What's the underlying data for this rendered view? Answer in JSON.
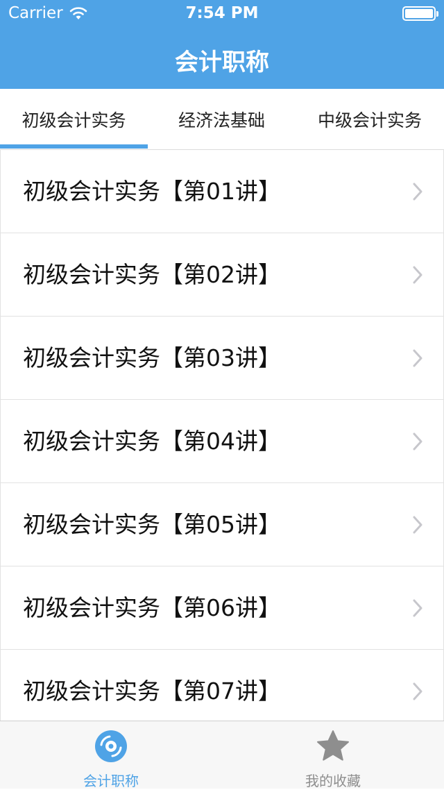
{
  "status_bar": {
    "carrier": "Carrier",
    "time": "7:54 PM"
  },
  "nav": {
    "title": "会计职称"
  },
  "tabs": [
    {
      "label": "初级会计实务",
      "selected": true
    },
    {
      "label": "经济法基础",
      "selected": false
    },
    {
      "label": "中级会计实务",
      "selected": false
    }
  ],
  "list": {
    "items": [
      {
        "label": "初级会计实务【第01讲】"
      },
      {
        "label": "初级会计实务【第02讲】"
      },
      {
        "label": "初级会计实务【第03讲】"
      },
      {
        "label": "初级会计实务【第04讲】"
      },
      {
        "label": "初级会计实务【第05讲】"
      },
      {
        "label": "初级会计实务【第06讲】"
      },
      {
        "label": "初级会计实务【第07讲】"
      }
    ]
  },
  "tabbar": {
    "items": [
      {
        "label": "会计职称",
        "icon": "disc-icon",
        "active": true
      },
      {
        "label": "我的收藏",
        "icon": "star-icon",
        "active": false
      }
    ]
  },
  "colors": {
    "accent": "#4fa3e6",
    "inactive": "#8e8e8e"
  }
}
